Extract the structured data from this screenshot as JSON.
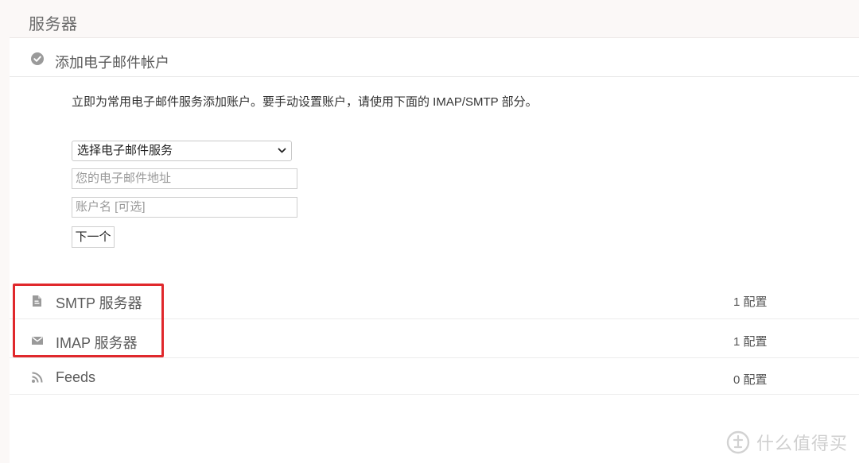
{
  "page": {
    "title": "服务器"
  },
  "add_account": {
    "title": "添加电子邮件帐户",
    "intro": "立即为常用电子邮件服务添加账户。要手动设置账户，请使用下面的 IMAP/SMTP 部分。",
    "service_select": {
      "selected": "选择电子邮件服务",
      "options": [
        "选择电子邮件服务"
      ]
    },
    "email_field": {
      "placeholder": "您的电子邮件地址"
    },
    "account_name_field": {
      "placeholder": "账户名 [可选]"
    },
    "next_label": "下一个"
  },
  "servers": [
    {
      "icon": "document-icon",
      "label": "SMTP 服务器",
      "count": "1 配置"
    },
    {
      "icon": "envelope-icon",
      "label": "IMAP 服务器",
      "count": "1 配置"
    },
    {
      "icon": "rss-feed-icon",
      "label": "Feeds",
      "count": "0 配置"
    }
  ],
  "watermark": {
    "text": "什么值得买"
  },
  "colors": {
    "highlight": "#e0282c",
    "header_bg": "#fbf8f7",
    "icon": "#9a9a9a"
  }
}
